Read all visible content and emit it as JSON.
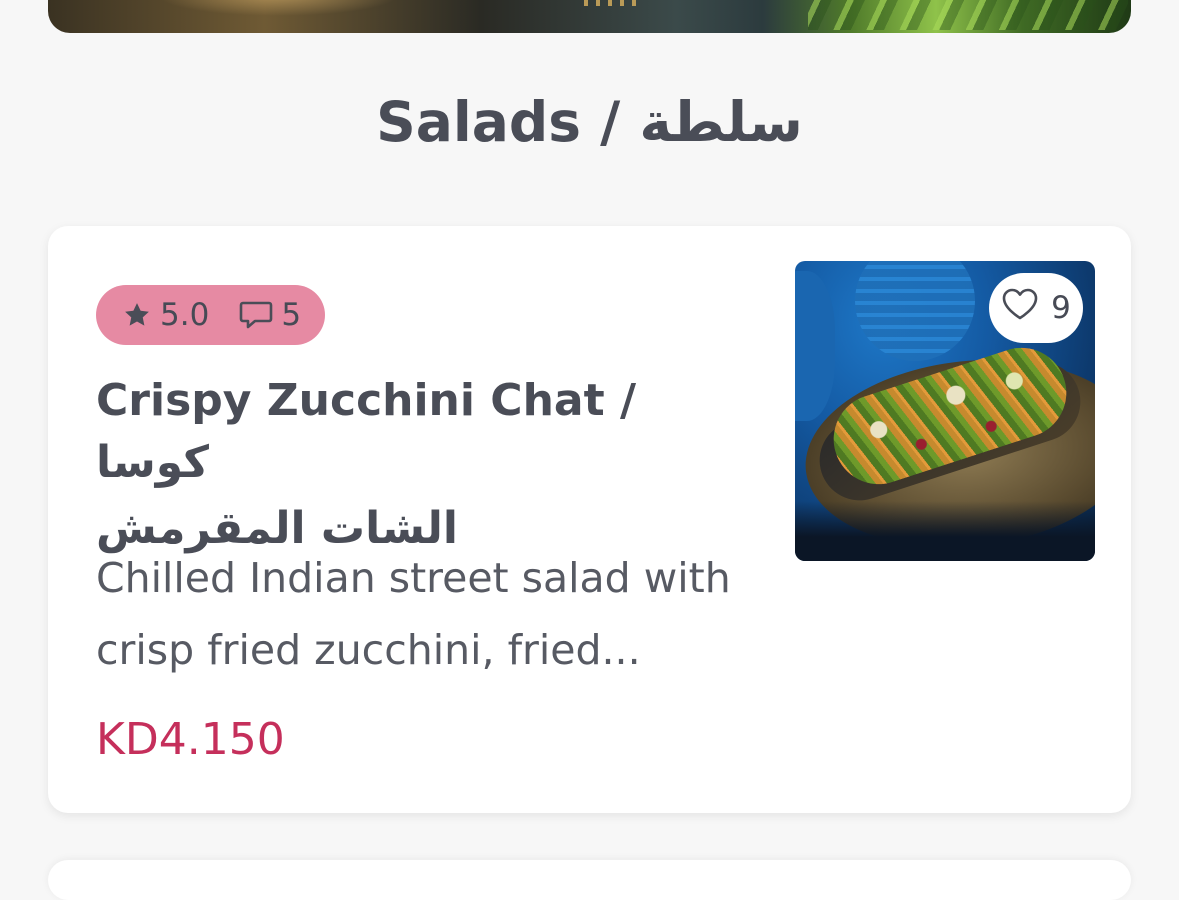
{
  "section": {
    "title": "Salads / سلطة"
  },
  "item": {
    "rating": "5.0",
    "comments_count": "5",
    "likes_count": "9",
    "title_line1": "Crispy Zucchini Chat / كوسا",
    "title_line2": "الشات المقرمش",
    "description": "Chilled Indian street salad with crisp fried zucchini, fried...",
    "price": "KD4.150"
  },
  "icons": {
    "rating": "star-icon",
    "comments": "speech-bubble-icon",
    "likes": "heart-icon"
  },
  "colors": {
    "background": "#f7f7f7",
    "rating_badge": "#e68aa3",
    "price": "#c52f5b",
    "text": "#4a4d57"
  }
}
